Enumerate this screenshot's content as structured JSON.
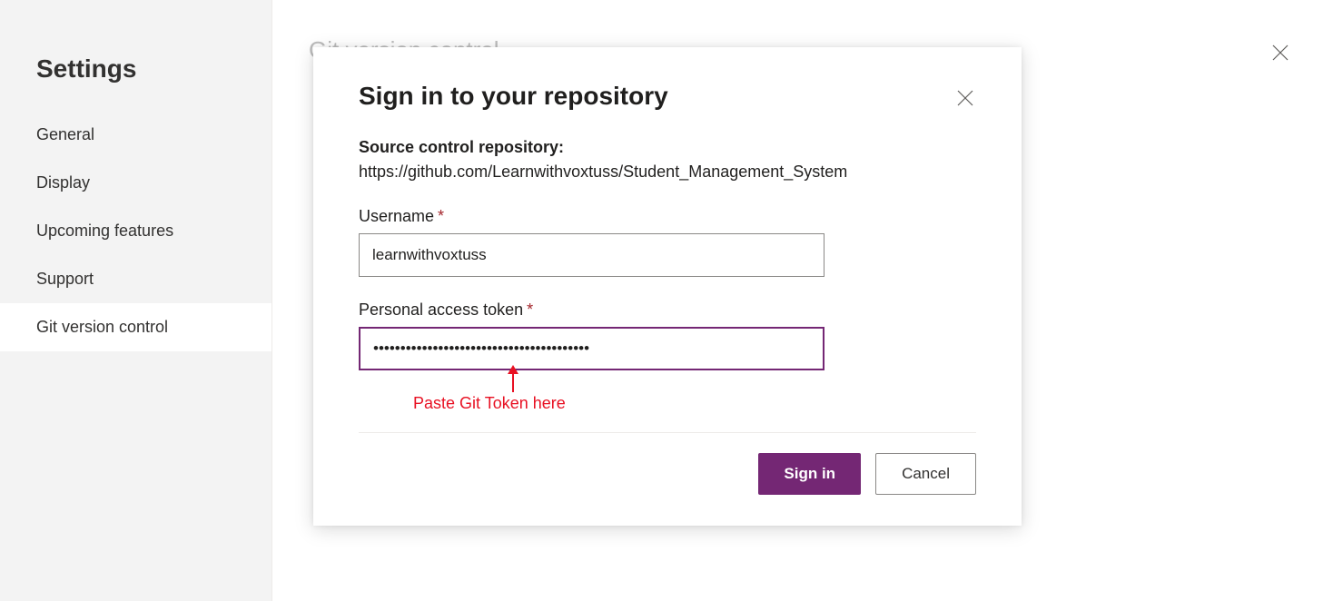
{
  "sidebar": {
    "title": "Settings",
    "items": [
      {
        "label": "General"
      },
      {
        "label": "Display"
      },
      {
        "label": "Upcoming features"
      },
      {
        "label": "Support"
      },
      {
        "label": "Git version control"
      }
    ]
  },
  "main": {
    "title": "Git version control"
  },
  "dialog": {
    "title": "Sign in to your repository",
    "repo_label": "Source control repository:",
    "repo_url": "https://github.com/Learnwithvoxtuss/Student_Management_System",
    "username_label": "Username",
    "username_value": "learnwithvoxtuss",
    "token_label": "Personal access token",
    "token_value": "••••••••••••••••••••••••••••••••••••••••",
    "annotation": "Paste Git Token here",
    "sign_in_label": "Sign in",
    "cancel_label": "Cancel"
  }
}
